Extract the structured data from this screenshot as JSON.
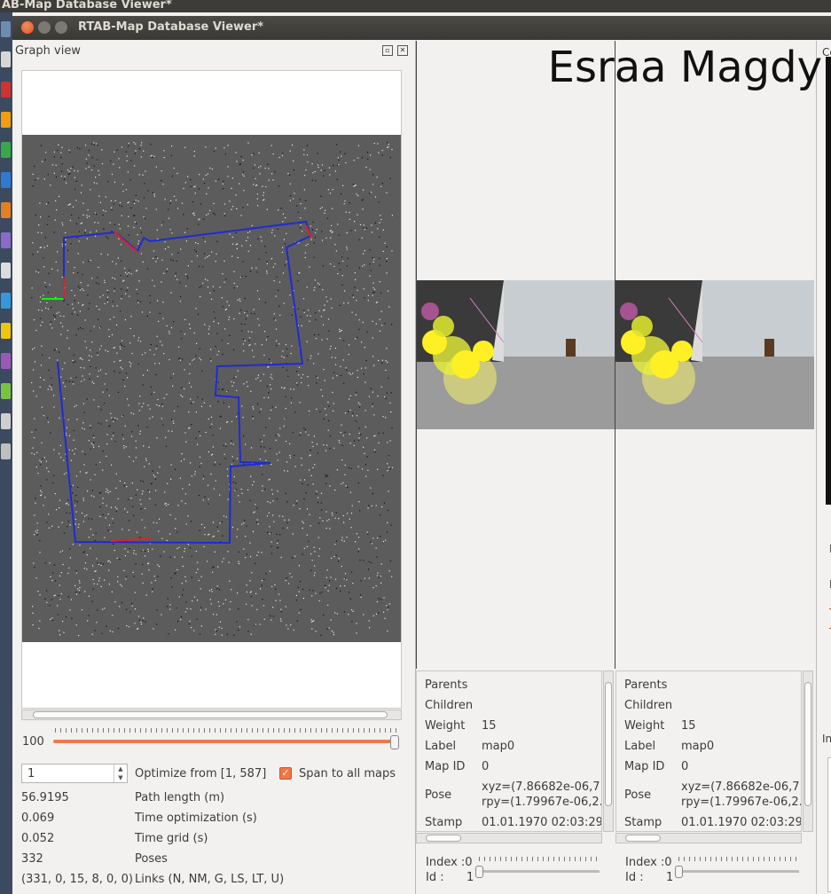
{
  "system": {
    "top_title": "AB-Map Database Viewer*"
  },
  "window": {
    "title": "RTAB-Map Database Viewer*"
  },
  "graph_view": {
    "title": "Graph view",
    "slider_value": "100",
    "optimize_value": "1",
    "optimize_label": "Optimize from [1, 587]",
    "span_label": "Span to all maps",
    "span_checked": true,
    "stats": [
      {
        "value": "56.9195",
        "label": "Path length (m)"
      },
      {
        "value": "0.069",
        "label": "Time optimization (s)"
      },
      {
        "value": "0.052",
        "label": "Time grid (s)"
      },
      {
        "value": "332",
        "label": "Poses"
      },
      {
        "value": "(331, 0, 15, 8, 0, 0)",
        "label": "Links (N, NM, G, LS, LT, U)"
      }
    ]
  },
  "watermark": "Esraa Magdy",
  "node_panels": [
    {
      "rows": [
        {
          "label": "Parents",
          "value": ""
        },
        {
          "label": "Children",
          "value": ""
        },
        {
          "label": "Weight",
          "value": "15"
        },
        {
          "label": "Label",
          "value": "map0"
        },
        {
          "label": "Map ID",
          "value": "0"
        },
        {
          "label": "Pose",
          "value": "xyz=(7.86682e-06,7.",
          "value2": "rpy=(1.79967e-06,2.:"
        },
        {
          "label": "Stamp",
          "value": "01.01.1970 02:03:29"
        }
      ],
      "index_label": "Index :0",
      "id_label": "Id :",
      "id_value": "1"
    },
    {
      "rows": [
        {
          "label": "Parents",
          "value": ""
        },
        {
          "label": "Children",
          "value": ""
        },
        {
          "label": "Weight",
          "value": "15"
        },
        {
          "label": "Label",
          "value": "map0"
        },
        {
          "label": "Map ID",
          "value": "0"
        },
        {
          "label": "Pose",
          "value": "xyz=(7.86682e-06,7.",
          "value2": "rpy=(1.79967e-06,2.:"
        },
        {
          "label": "Stamp",
          "value": "01.01.1970 02:03:29"
        }
      ],
      "index_label": "Index :0",
      "id_label": "Id :",
      "id_value": "1"
    }
  ],
  "right_strip": {
    "c": "Co",
    "n": "N",
    "l": "L",
    "t1": "T",
    "t2": "T",
    "i": "In"
  },
  "colors": {
    "accent": "#ee7a4b",
    "map_bg": "#5c5c5c",
    "path": "#1f2bd6",
    "highlight": "#e0202a"
  }
}
